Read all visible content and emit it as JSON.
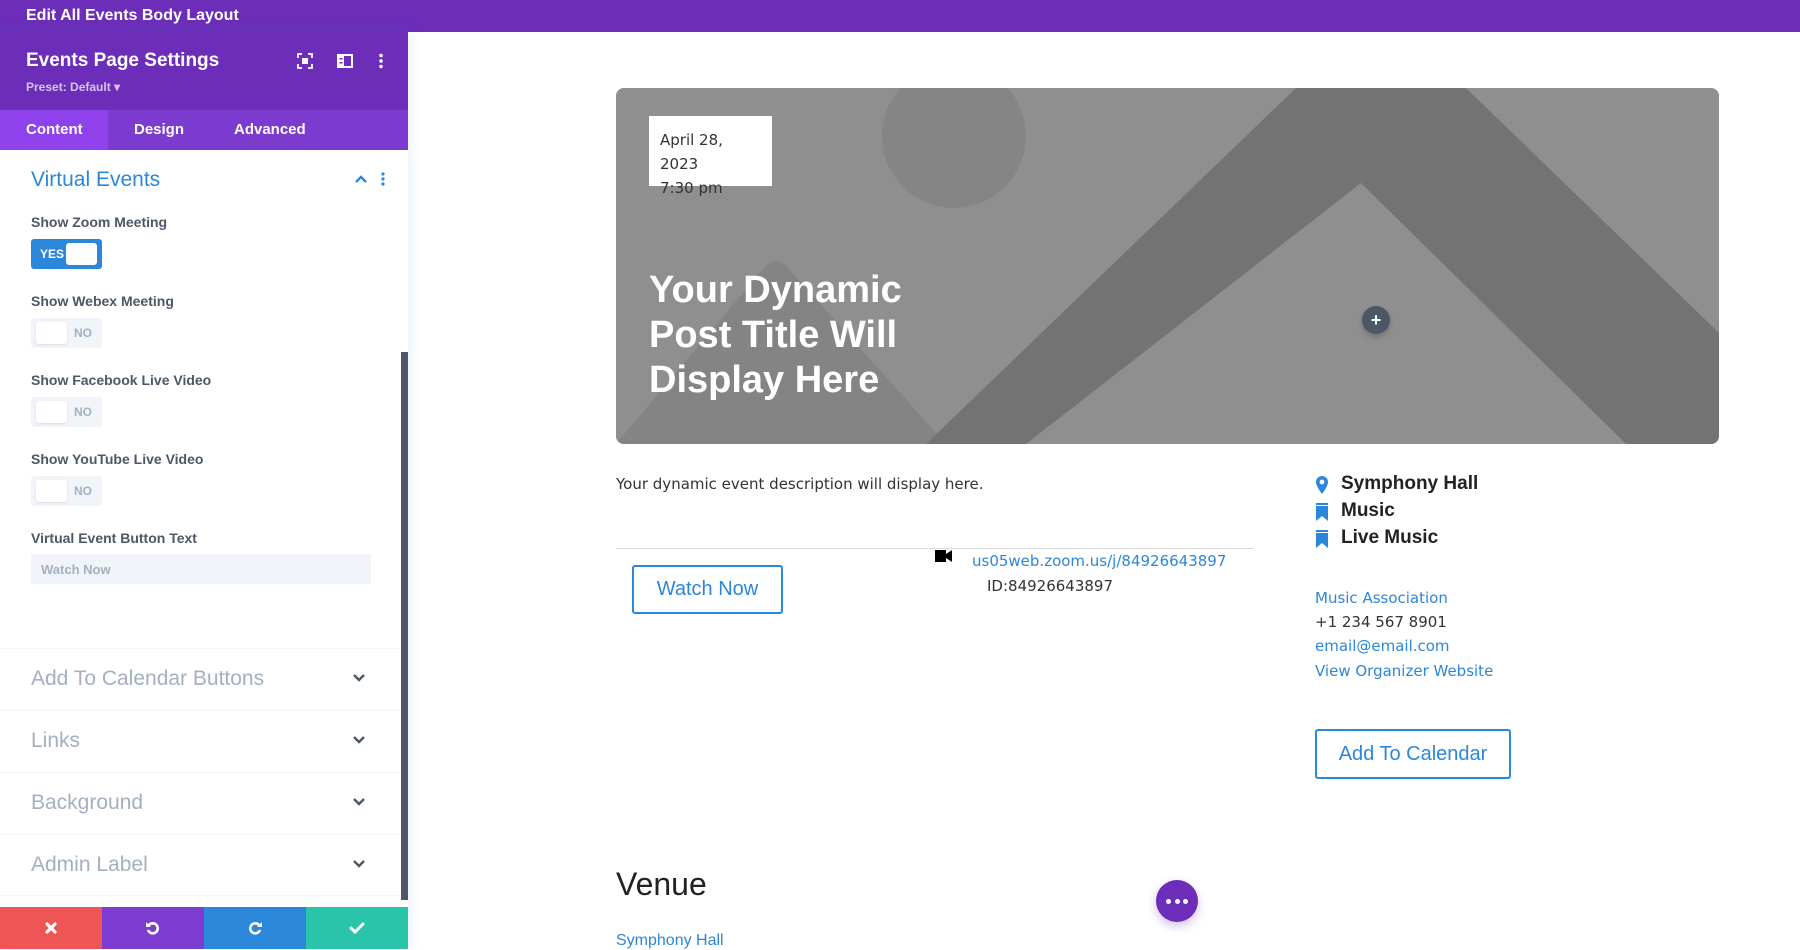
{
  "topbar": {
    "title": "Edit All Events Body Layout"
  },
  "panel": {
    "title": "Events Page Settings",
    "preset": "Preset: Default ▾",
    "header_icons": [
      "expand-icon",
      "sidebar-layout-icon",
      "more-vertical-icon"
    ],
    "tabs": [
      {
        "label": "Content",
        "active": true
      },
      {
        "label": "Design",
        "active": false
      },
      {
        "label": "Advanced",
        "active": false
      }
    ],
    "section": {
      "title": "Virtual Events",
      "fields": [
        {
          "label": "Show Zoom Meeting",
          "value": "YES",
          "on": true
        },
        {
          "label": "Show Webex Meeting",
          "value": "NO",
          "on": false
        },
        {
          "label": "Show Facebook Live Video",
          "value": "NO",
          "on": false
        },
        {
          "label": "Show YouTube Live Video",
          "value": "NO",
          "on": false
        }
      ],
      "button_text_label": "Virtual Event Button Text",
      "button_text_placeholder": "Watch Now",
      "button_text_value": ""
    },
    "collapsed_sections": [
      {
        "label": "Add To Calendar Buttons"
      },
      {
        "label": "Links"
      },
      {
        "label": "Background"
      },
      {
        "label": "Admin Label"
      }
    ],
    "footer": {
      "buttons": [
        {
          "name": "discard",
          "icon": "close-icon",
          "color": "#ef5555"
        },
        {
          "name": "undo",
          "icon": "undo-icon",
          "color": "#7e3bd0"
        },
        {
          "name": "redo",
          "icon": "redo-icon",
          "color": "#2b87da"
        },
        {
          "name": "save",
          "icon": "check-icon",
          "color": "#29c4a9"
        }
      ]
    }
  },
  "colors": {
    "brand_purple": "#6c2eb9",
    "tab_bar": "#7b3bcf",
    "tab_active": "#8f42ec",
    "link_blue": "#2b87da",
    "muted": "#a2b0c1",
    "text_dark": "#4c5866"
  },
  "event": {
    "date": "April 28, 2023",
    "time": "7:30 pm",
    "title": "Your Dynamic Post Title Will Display Here",
    "description": "Your dynamic event description will display here.",
    "watch_button": "Watch Now",
    "zoom_link": "us05web.zoom.us/j/84926643897",
    "zoom_id": "ID:84926643897",
    "meta": [
      {
        "icon": "map-pin-icon",
        "text": "Symphony Hall"
      },
      {
        "icon": "bookmark-icon",
        "text": "Music"
      },
      {
        "icon": "bookmark-icon",
        "text": "Live Music"
      }
    ],
    "organizer": {
      "name": "Music Association",
      "phone": "+1 234 567 8901",
      "email": "email@email.com",
      "website": "View Organizer Website"
    },
    "add_to_calendar": "Add To Calendar",
    "venue_heading": "Venue",
    "venue_name": "Symphony Hall"
  }
}
